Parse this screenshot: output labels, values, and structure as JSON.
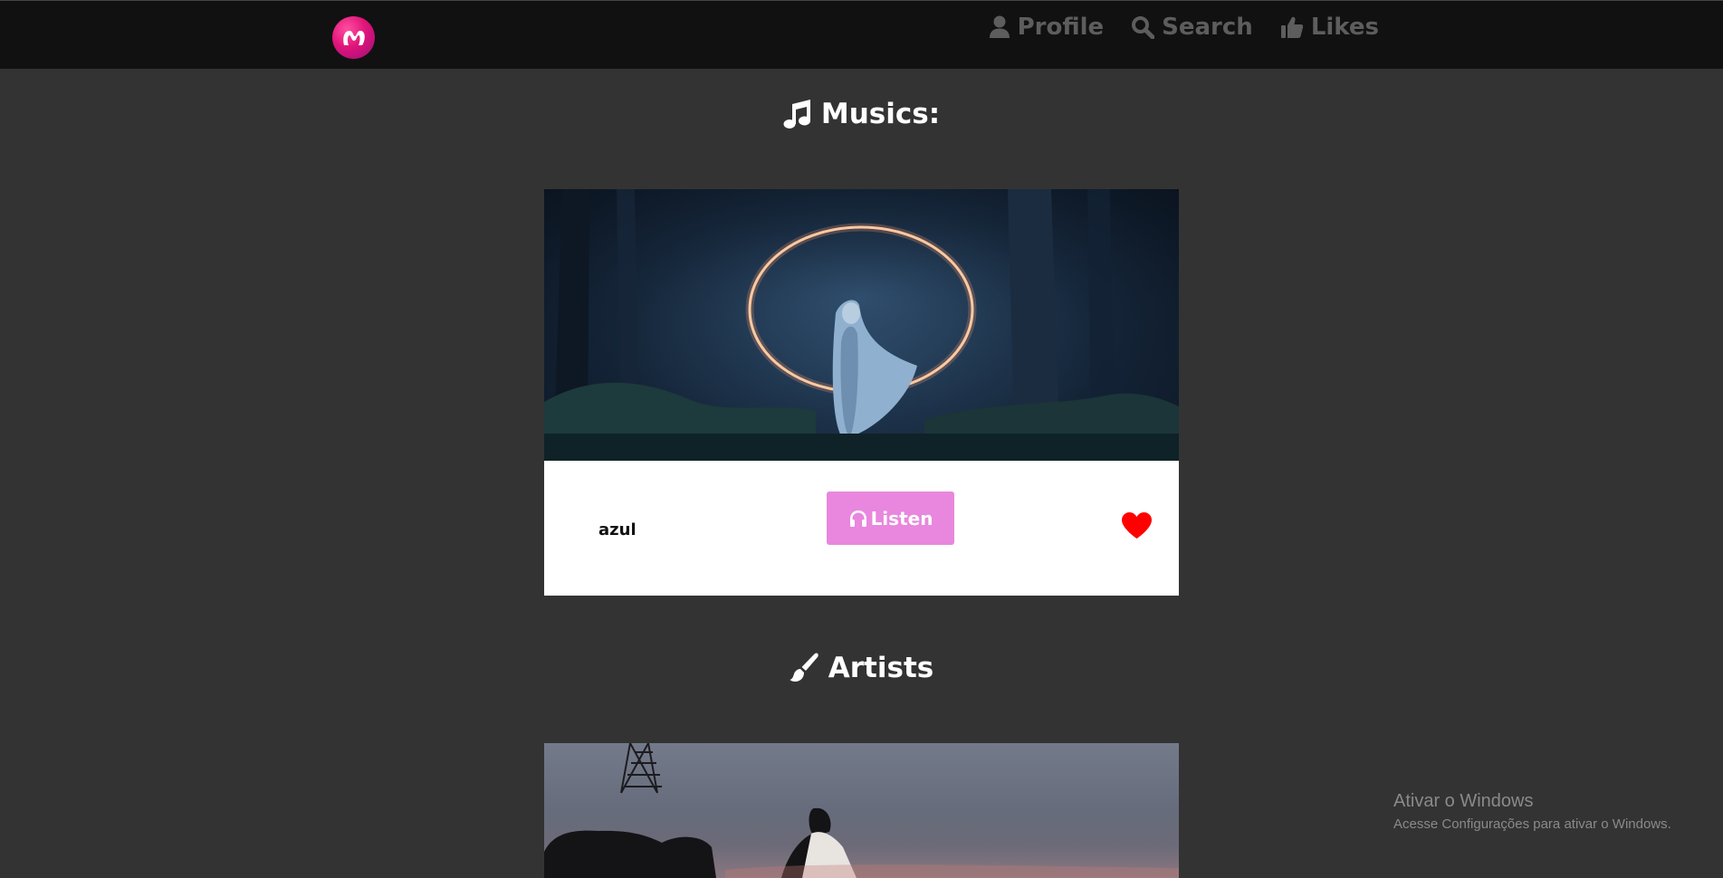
{
  "nav": {
    "profile_label": "Profile",
    "search_label": "Search",
    "likes_label": "Likes"
  },
  "musics_section": {
    "title": "Musics:",
    "card": {
      "title": "azul",
      "listen_label": "Listen"
    }
  },
  "artists_section": {
    "title": "Artists"
  },
  "watermark": {
    "title": "Ativar o Windows",
    "subtitle": "Acesse Configurações para ativar o Windows."
  },
  "icons": {
    "logo": "music-app-logo",
    "profile": "user-icon",
    "search": "search-icon",
    "likes": "thumbs-up-icon",
    "musics": "music-note-icon",
    "artists": "paint-brush-icon",
    "listen": "headphones-icon",
    "like": "heart-icon"
  },
  "colors": {
    "background": "#333333",
    "navbar": "#111111",
    "nav_text": "#5d5d5d",
    "accent": "#e887dd",
    "heart": "#ff0000",
    "logo": "#e0147a"
  }
}
